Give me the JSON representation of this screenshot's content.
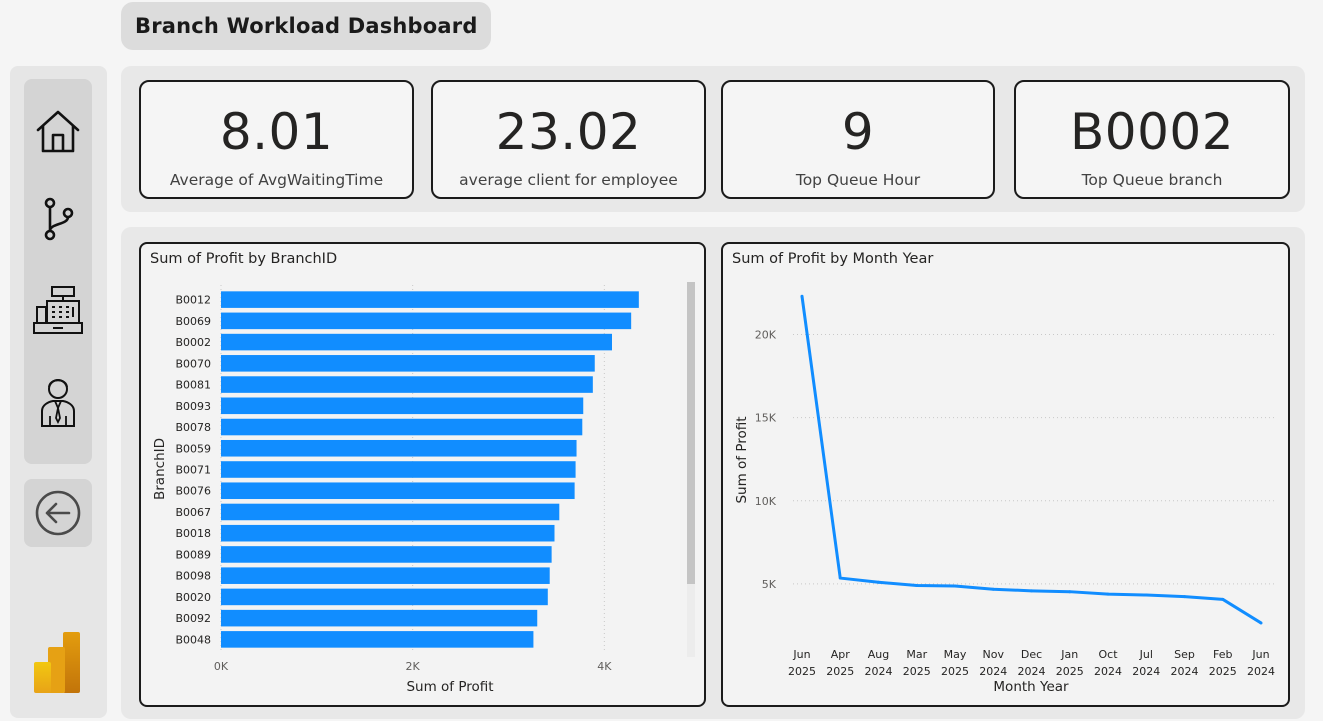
{
  "dashboard": {
    "title": "Branch Workload Dashboard"
  },
  "navigation": {
    "items": [
      {
        "icon": "home-icon"
      },
      {
        "icon": "branch-icon"
      },
      {
        "icon": "cash-register-icon"
      },
      {
        "icon": "employee-icon"
      }
    ],
    "back_icon": "back-arrow-icon",
    "logo_icon": "power-bi-logo-icon"
  },
  "kpis": [
    {
      "value": "8.01",
      "label": "Average of AvgWaitingTime"
    },
    {
      "value": "23.02",
      "label": "average client for employee"
    },
    {
      "value": "9",
      "label": "Top Queue Hour"
    },
    {
      "value": "B0002",
      "label": "Top Queue branch"
    }
  ],
  "colors": {
    "accent": "#118dff",
    "card_border": "#1b1b1b",
    "background": "#f5f5f5"
  },
  "chart_data": [
    {
      "type": "bar",
      "orientation": "horizontal",
      "title": "Sum of Profit by BranchID",
      "xlabel": "Sum of Profit",
      "ylabel": "BranchID",
      "xlim": [
        0,
        4800
      ],
      "xticks": [
        0,
        2000,
        4000
      ],
      "xtick_labels": [
        "0K",
        "2K",
        "4K"
      ],
      "grid": true,
      "categories": [
        "B0012",
        "B0069",
        "B0002",
        "B0070",
        "B0081",
        "B0093",
        "B0078",
        "B0059",
        "B0071",
        "B0076",
        "B0067",
        "B0018",
        "B0089",
        "B0098",
        "B0020",
        "B0092",
        "B0048"
      ],
      "values": [
        4360,
        4280,
        4080,
        3900,
        3880,
        3780,
        3770,
        3710,
        3700,
        3690,
        3530,
        3480,
        3450,
        3430,
        3410,
        3300,
        3260
      ]
    },
    {
      "type": "line",
      "title": "Sum of Profit by Month Year",
      "xlabel": "Month Year",
      "ylabel": "Sum of Profit",
      "ylim": [
        0,
        24000
      ],
      "yticks": [
        5000,
        10000,
        15000,
        20000
      ],
      "ytick_labels": [
        "5K",
        "10K",
        "15K",
        "20K"
      ],
      "grid": true,
      "categories": [
        [
          "Jun",
          "2025"
        ],
        [
          "Apr",
          "2025"
        ],
        [
          "Aug",
          "2024"
        ],
        [
          "Mar",
          "2025"
        ],
        [
          "May",
          "2025"
        ],
        [
          "Nov",
          "2024"
        ],
        [
          "Dec",
          "2024"
        ],
        [
          "Jan",
          "2025"
        ],
        [
          "Oct",
          "2024"
        ],
        [
          "Jul",
          "2024"
        ],
        [
          "Sep",
          "2024"
        ],
        [
          "Feb",
          "2025"
        ],
        [
          "Jun",
          "2024"
        ]
      ],
      "values": [
        22300,
        5350,
        5100,
        4900,
        4870,
        4680,
        4580,
        4530,
        4380,
        4330,
        4230,
        4070,
        2650
      ]
    }
  ]
}
